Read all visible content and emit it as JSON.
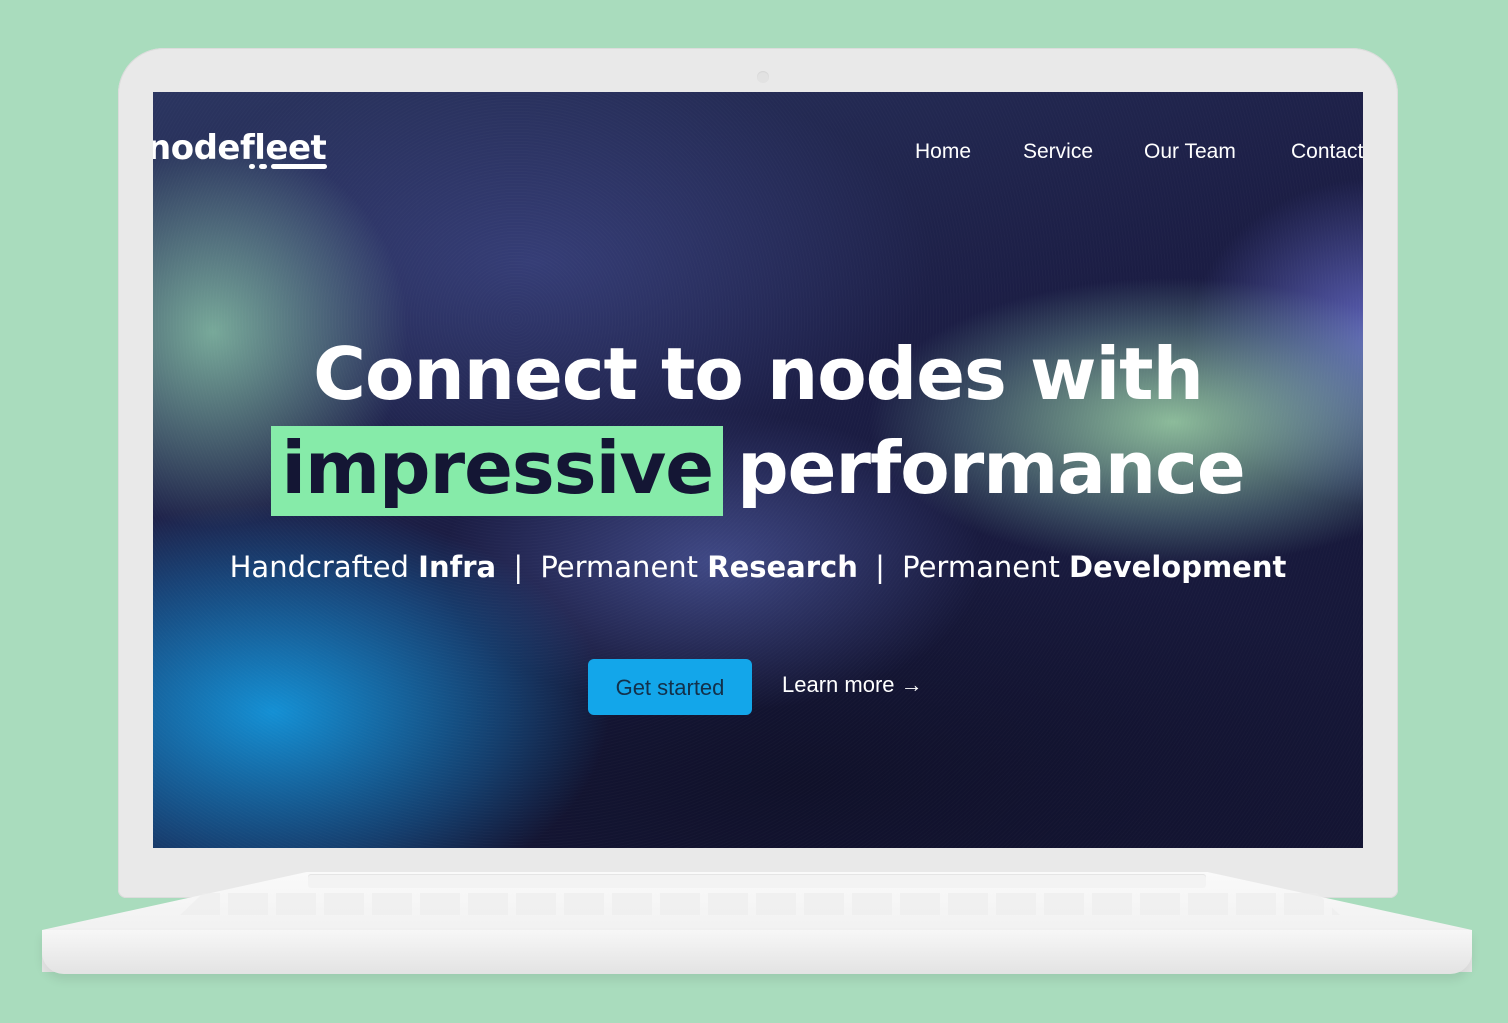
{
  "brand": {
    "logo_text": "nodefleet"
  },
  "nav": {
    "items": [
      {
        "label": "Home"
      },
      {
        "label": "Service"
      },
      {
        "label": "Our Team"
      },
      {
        "label": "Contact"
      }
    ]
  },
  "hero": {
    "headline_line1": "Connect to nodes with",
    "headline_highlight": "impressive",
    "headline_rest": "performance",
    "tagline": [
      {
        "prefix": "Handcrafted",
        "bold": "Infra"
      },
      {
        "prefix": "Permanent",
        "bold": "Research"
      },
      {
        "prefix": "Permanent",
        "bold": "Development"
      }
    ],
    "separator": "|",
    "primary_button": "Get started",
    "secondary_link": "Learn more →"
  },
  "colors": {
    "page_background": "#a9dcbd",
    "highlight": "#86eba9",
    "primary_button": "#13a6ea",
    "screen_dark": "#151632"
  }
}
